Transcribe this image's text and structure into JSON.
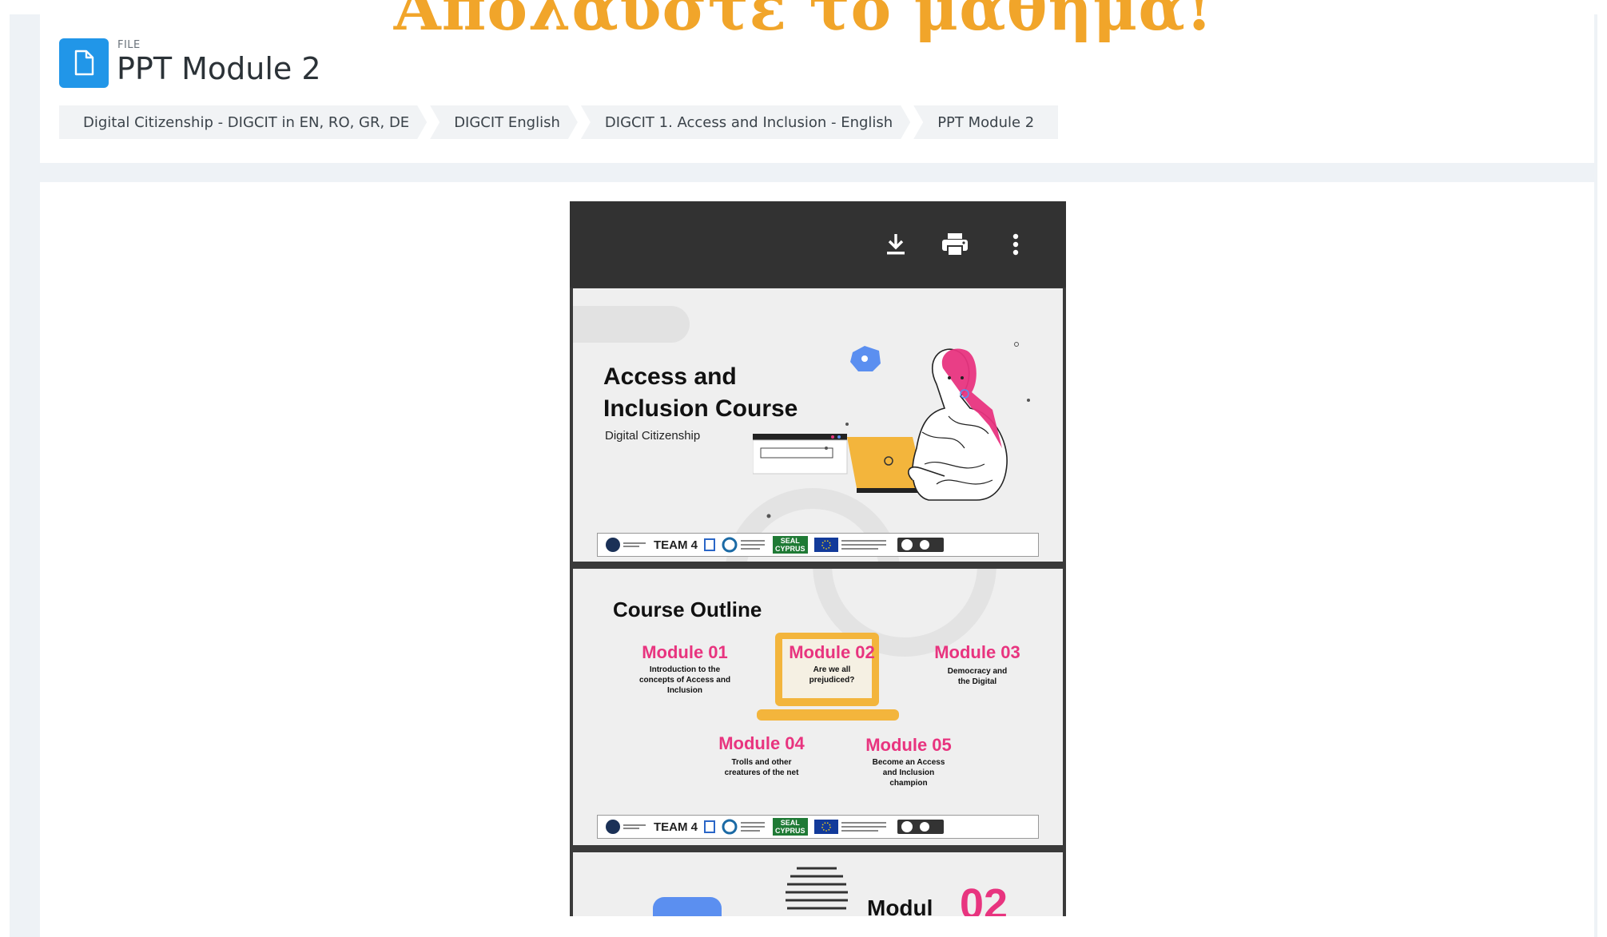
{
  "overlay_banner": "Απολαύστε το μάθημα!",
  "header": {
    "file_label": "FILE",
    "title": "PPT Module 2",
    "icon": "file-icon"
  },
  "breadcrumb": [
    {
      "label": "Digital Citizenship - DIGCIT in EN, RO, GR, DE"
    },
    {
      "label": "DIGCIT English"
    },
    {
      "label": "DIGCIT 1. Access and Inclusion - English"
    },
    {
      "label": "PPT Module 2"
    }
  ],
  "viewer": {
    "toolbar_icons": [
      "download-icon",
      "print-icon",
      "more-vertical-icon"
    ],
    "slide1": {
      "title_line1": "Access and",
      "title_line2": "Inclusion Course",
      "subtitle": "Digital Citizenship"
    },
    "slide2": {
      "title": "Course Outline",
      "modules": [
        {
          "title": "Module 01",
          "desc_line1": "Introduction to the",
          "desc_line2": "concepts of Access and",
          "desc_line3": "Inclusion"
        },
        {
          "title": "Module 02",
          "desc_line1": "Are we all",
          "desc_line2": "prejudiced?",
          "desc_line3": ""
        },
        {
          "title": "Module 03",
          "desc_line1": "Democracy and",
          "desc_line2": "the Digital",
          "desc_line3": ""
        },
        {
          "title": "Module 04",
          "desc_line1": "Trolls and other",
          "desc_line2": "creatures of the net",
          "desc_line3": ""
        },
        {
          "title": "Module 05",
          "desc_line1": "Become an Access",
          "desc_line2": "and Inclusion",
          "desc_line3": "champion"
        }
      ]
    },
    "slide3": {
      "partial_text": "Modul",
      "partial_number": "02"
    },
    "logo_strip": {
      "team": "TEAM 4",
      "seal_line1": "SEAL",
      "seal_line2": "CYPRUS"
    }
  },
  "colors": {
    "accent_blue": "#2196e8",
    "banner_orange": "#f1a52a",
    "module_pink": "#e8347f",
    "laptop_yellow": "#f3b53c",
    "toolbar_dark": "#323232"
  }
}
